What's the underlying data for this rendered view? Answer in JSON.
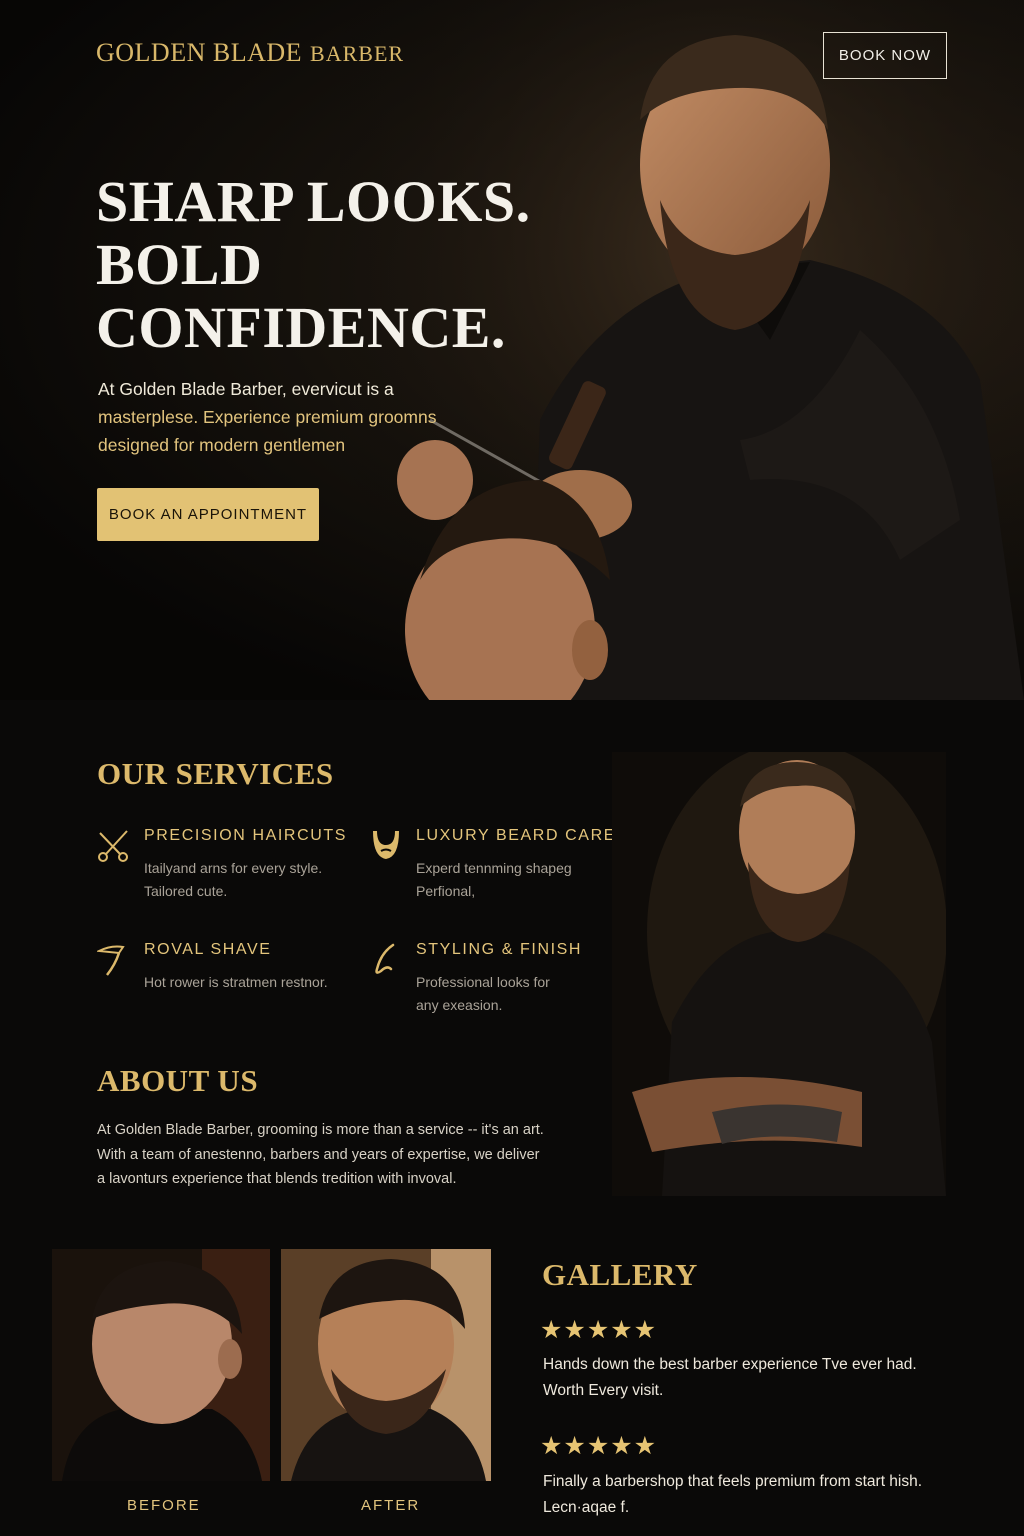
{
  "brand": {
    "name": "GOLDEN BLADE",
    "suffix": "BARBER"
  },
  "nav": {
    "book_now": "BOOK NOW"
  },
  "hero": {
    "title_lines": [
      "SHARP LOOKS.",
      "BOLD",
      "CONFIDENCE."
    ],
    "copy_line1": "At Golden Blade Barber, evervicut is a",
    "copy_line2": "masterplese. Experience premium groomns",
    "copy_line3": "designed for modern gentlemen",
    "cta": "BOOK AN APPOINTMENT"
  },
  "services": {
    "title": "OUR SERVICES",
    "items": [
      {
        "title": "PRECISION HAIRCUTS",
        "desc_line1": "Itailyand arns for every style.",
        "desc_line2": "Tailored cute.",
        "icon": "scissors-icon"
      },
      {
        "title": "LUXURY BEARD CARE",
        "desc_line1": "Experd tennming shapeg",
        "desc_line2": "Perfional,",
        "icon": "beard-icon"
      },
      {
        "title": "ROVAL SHAVE",
        "desc_line1": "Hot rower is stratmen restnor.",
        "desc_line2": "",
        "icon": "razor-icon"
      },
      {
        "title": "STYLING & FINISH",
        "desc_line1": "Professional looks for",
        "desc_line2": "any exeasion.",
        "icon": "styling-icon"
      }
    ]
  },
  "about": {
    "title": "ABOUT US",
    "line1": "At Golden Blade Barber, grooming is more than a service -- it's an art.",
    "line2": "With a team of anestenno, barbers and years of expertise, we deliver",
    "line3": "a lavonturs experience that blends tredition with invoval."
  },
  "gallery": {
    "title": "GALLERY",
    "before_label": "BEFORE",
    "after_label": "AFTER",
    "reviews": [
      {
        "stars": "★★★★★",
        "rating": 5,
        "line1": "Hands down the best barber experience Tve ever had.",
        "line2": "Worth Every visit."
      },
      {
        "stars": "★★★★★",
        "rating": 5,
        "line1": "Finally a barbershop that feels premium from start hish.",
        "line2": "Lecn·aqae f."
      }
    ]
  },
  "colors": {
    "gold": "#dcb96b",
    "button_gold": "#e2c274",
    "background": "#0a0908",
    "text": "#e8e2d4"
  }
}
